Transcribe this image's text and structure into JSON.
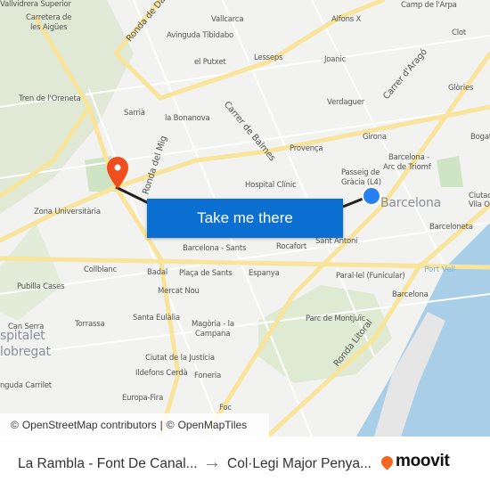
{
  "map": {
    "labels": [
      "Vallvidrera Superior",
      "Carretera de",
      "les Aigües",
      "Ronda de Dalt",
      "Vallcarca",
      "Avinguda Tibidabo",
      "Alfons X",
      "Camp de l'Arpa",
      "Clot",
      "el Putxet",
      "Lesseps",
      "Joanic",
      "Carrer de Balmes",
      "Carrer d'Aragó",
      "Glòries",
      "Tren de l'Oreneta",
      "Sarrià",
      "la Bonanova",
      "Verdaguer",
      "Ronda del Mig",
      "Girona",
      "Bogat",
      "Provença",
      "Barcelona -",
      "Arc de Triomf",
      "Passeig de",
      "Gràcia (L4)",
      "Hospital Clínic",
      "Zona Universitària",
      "Barcelona",
      "Ciutad",
      "Vila Ol",
      "Barcelona - Sants",
      "Rocafort",
      "Sant Antoni",
      "Barceloneta",
      "Collblanc",
      "Badal",
      "Plaça de Sants",
      "Espanya",
      "Port Vell",
      "Pubilla Cases",
      "Mercat Nou",
      "Paral·lel (Funicular)",
      "Barcelona",
      "Can Serra",
      "Torrassa",
      "Santa Eulàlia",
      "Magòria - la",
      "Campana",
      "Parc de Montjuïc",
      "spitalet",
      "lobregat",
      "Ciutat de la Justícia",
      "nguda Carrilet",
      "Ildefons Cerdà",
      "Foneria",
      "Europa-Fira",
      "Ronda Litoral",
      "Foc"
    ],
    "origin_marker_color": "#f04e1f",
    "destination_marker_color": "#2a7ff0",
    "route_line_color": "#222222"
  },
  "cta": {
    "label": "Take me there",
    "color": "#0a6fd1"
  },
  "attribution": {
    "symbol": "©",
    "osm": "OpenStreetMap contributors",
    "separator": "|",
    "omt": "OpenMapTiles"
  },
  "footer": {
    "from": "La Rambla - Font De Canal...",
    "arrow": "→",
    "to": "Col·Legi Major Penya...",
    "brand": "moovit",
    "brand_color": "#f26522"
  }
}
